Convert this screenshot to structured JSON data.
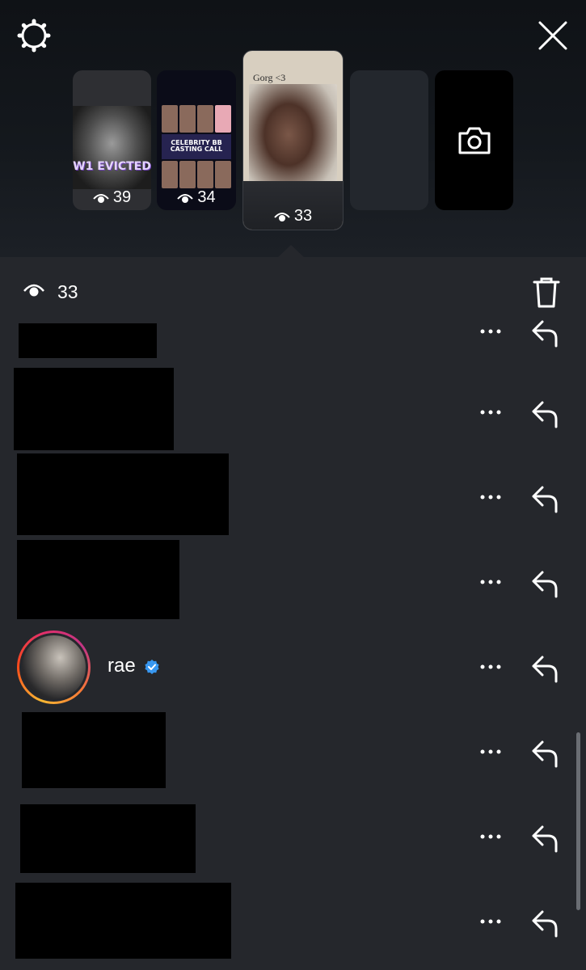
{
  "header": {
    "settings_icon": "settings-gear-icon",
    "close_icon": "close-x-icon"
  },
  "stories": [
    {
      "caption": "W1 EVICTED",
      "views": "39"
    },
    {
      "caption": "CELEBRITY BB CASTING CALL",
      "views": "34"
    },
    {
      "title": "Gorg <3",
      "views": "33",
      "selected": true
    },
    {
      "placeholder": true
    },
    {
      "camera_icon": "camera-icon"
    }
  ],
  "summary": {
    "view_count": "33",
    "trash_icon": "trash-icon"
  },
  "viewers": [
    {
      "redacted": true
    },
    {
      "redacted": true
    },
    {
      "redacted": true
    },
    {
      "redacted": true
    },
    {
      "username": "rae",
      "verified": true
    },
    {
      "redacted": true
    },
    {
      "redacted": true
    },
    {
      "redacted": true
    }
  ],
  "colors": {
    "panel_bg": "#25272c",
    "top_bg": "#0f1216",
    "verified_blue": "#3897f0",
    "text": "#ffffff"
  }
}
